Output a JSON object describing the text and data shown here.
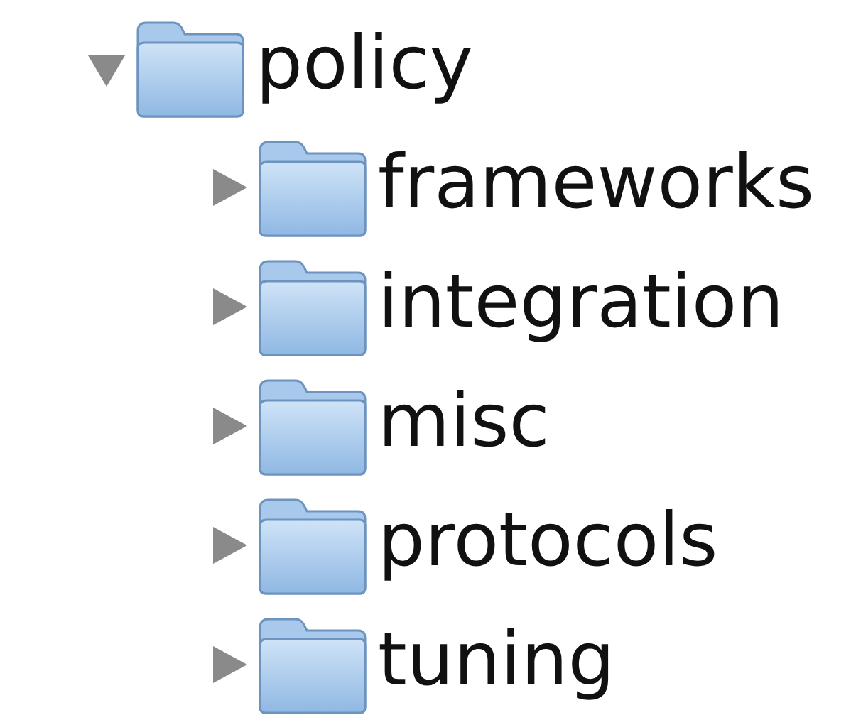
{
  "tree": [
    {
      "label": "policy",
      "expanded": true,
      "children": [
        {
          "label": "frameworks",
          "expanded": false
        },
        {
          "label": "integration",
          "expanded": false
        },
        {
          "label": "misc",
          "expanded": false
        },
        {
          "label": "protocols",
          "expanded": false
        },
        {
          "label": "tuning",
          "expanded": false
        }
      ]
    }
  ]
}
